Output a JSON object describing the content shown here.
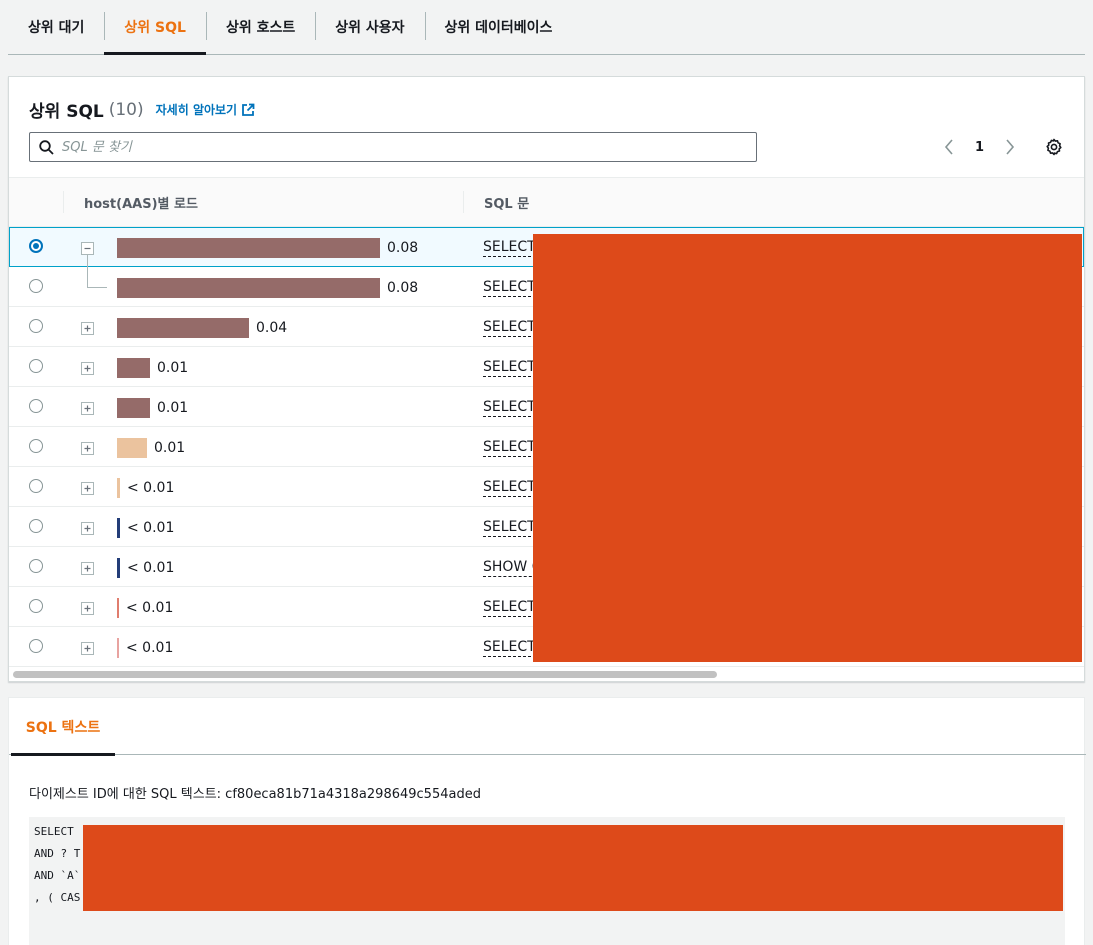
{
  "top_tabs": [
    "상위 대기",
    "상위 SQL",
    "상위 호스트",
    "상위 사용자",
    "상위 데이터베이스"
  ],
  "active_tab_index": 1,
  "panel": {
    "title": "상위 SQL",
    "count": "(10)",
    "info_link": "자세히 알아보기",
    "search_placeholder": "SQL 문 찾기",
    "page": "1"
  },
  "table": {
    "columns": [
      "host(AAS)별 로드",
      "SQL 문"
    ],
    "rows": [
      {
        "load": "0.08",
        "load_value": 0.08,
        "bar_color": "#956b69",
        "sql": "SELECT",
        "selected": true,
        "expander": "collapse"
      },
      {
        "load": "0.08",
        "load_value": 0.08,
        "bar_color": "#956b69",
        "sql": "SELECT",
        "selected": false,
        "expander": "child"
      },
      {
        "load": "0.04",
        "load_value": 0.04,
        "bar_color": "#956b69",
        "sql": "SELECT",
        "selected": false,
        "expander": "expand"
      },
      {
        "load": "0.01",
        "load_value": 0.01,
        "bar_color": "#956b69",
        "sql": "SELECT",
        "selected": false,
        "expander": "expand"
      },
      {
        "load": "0.01",
        "load_value": 0.01,
        "bar_color": "#956b69",
        "sql": "SELECT",
        "selected": false,
        "expander": "expand"
      },
      {
        "load": "0.01",
        "load_value": 0.009,
        "bar_color": "#ebc39e",
        "sql": "SELECT",
        "selected": false,
        "expander": "expand"
      },
      {
        "load": "< 0.01",
        "load_value": 0.001,
        "bar_color": "#ebc39e",
        "sql": "SELECT",
        "selected": false,
        "expander": "expand"
      },
      {
        "load": "< 0.01",
        "load_value": 0.0008,
        "bar_color": "#233d78",
        "sql": "SELECT",
        "selected": false,
        "expander": "expand"
      },
      {
        "load": "< 0.01",
        "load_value": 0.0008,
        "bar_color": "#233d78",
        "sql": "SHOW C",
        "selected": false,
        "expander": "expand"
      },
      {
        "load": "< 0.01",
        "load_value": 0.0006,
        "bar_color": "#e07d6e",
        "sql": "SELECT",
        "selected": false,
        "expander": "expand"
      },
      {
        "load": "< 0.01",
        "load_value": 0.0004,
        "bar_color": "#e8a3a0",
        "sql": "SELECT",
        "selected": false,
        "expander": "expand"
      }
    ],
    "max_load": 0.08
  },
  "sql_text": {
    "tab_label": "SQL 텍스트",
    "digest_line": "다이제스트 ID에 대한 SQL 텍스트: cf80eca81b71a4318a298649c554aded",
    "code_lines": [
      "SELECT",
      "AND ? T",
      "AND `A`",
      ", ( CAS"
    ]
  },
  "colors": {
    "accent": "#ec7211",
    "link": "#0073bb",
    "redaction": "#dd4a1a"
  }
}
